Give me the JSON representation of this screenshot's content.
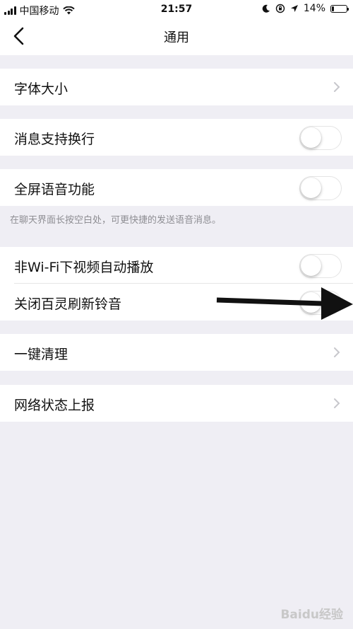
{
  "status_bar": {
    "carrier": "中国移动",
    "time": "21:57",
    "battery": "14%",
    "battery_level": 0.14
  },
  "nav": {
    "title": "通用"
  },
  "settings": {
    "font_size": {
      "label": "字体大小"
    },
    "message_wrap": {
      "label": "消息支持换行",
      "enabled": false
    },
    "fullscreen_voice": {
      "label": "全屏语音功能",
      "enabled": false,
      "hint": "在聊天界面长按空白处，可更快捷的发送语音消息。"
    },
    "autoplay_video": {
      "label": "非Wi-Fi下视频自动播放",
      "enabled": false
    },
    "refresh_ringtone": {
      "label": "关闭百灵刷新铃音",
      "enabled": false
    },
    "one_click_clean": {
      "label": "一键清理"
    },
    "network_report": {
      "label": "网络状态上报"
    }
  },
  "watermark": "Baidu经验",
  "icons": {
    "back": "chevron-left-icon",
    "row_arrow": "chevron-right-icon",
    "wifi": "wifi-icon",
    "moon": "moon-icon",
    "location": "location-icon"
  }
}
